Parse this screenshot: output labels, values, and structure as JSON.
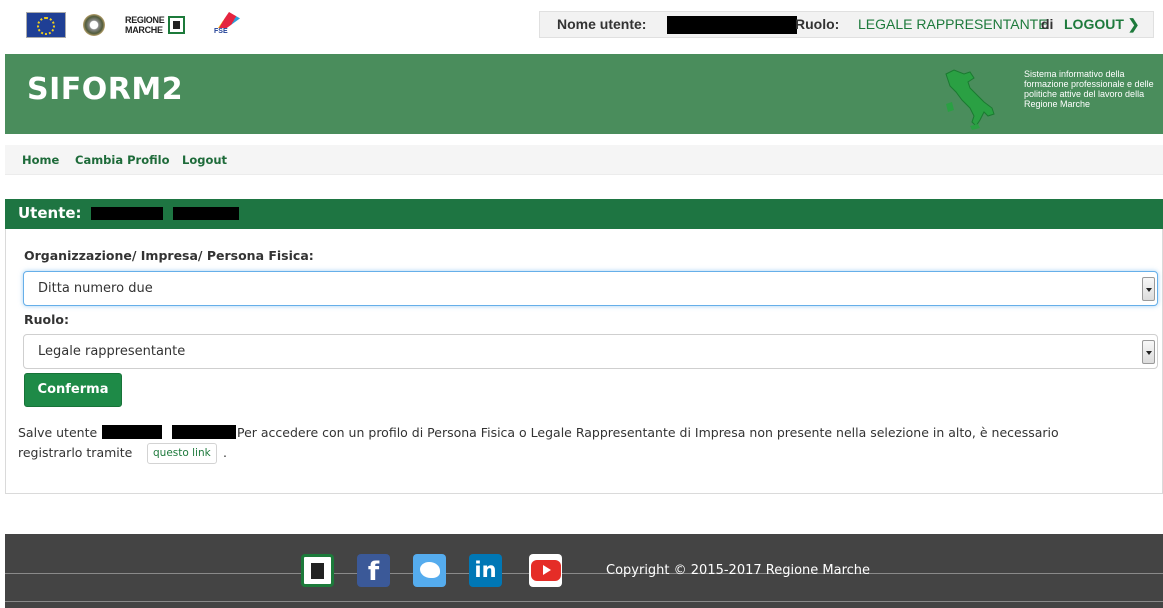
{
  "topbar": {
    "logos": {
      "eu": "eu-flag-logo",
      "italy": "italian-republic-emblem",
      "region": "REGIONE MARCHE",
      "fse": "FSE"
    },
    "user": {
      "username_label": "Nome utente:",
      "role_label": "Ruolo:",
      "role_value": "LEGALE RAPPRESENTANTE",
      "di": "di",
      "logout": "LOGOUT ❯"
    }
  },
  "header": {
    "brand": "SIFORM2",
    "description": "Sistema informativo della formazione professionale e delle politiche attive del lavoro della Regione Marche"
  },
  "nav": {
    "items": [
      "Home",
      "Cambia Profilo",
      "Logout"
    ]
  },
  "panel": {
    "title": "Utente:",
    "org_label": "Organizzazione/ Impresa/ Persona Fisica:",
    "org_value": "Ditta numero due",
    "role_label": "Ruolo:",
    "role_value": "Legale rappresentante",
    "confirm": "Conferma",
    "note_prefix": "Salve utente",
    "note_line1": "Per accedere con un profilo di Persona Fisica o Legale Rappresentante di Impresa non presente nella selezione in alto, è necessario",
    "note_line2": "registrarlo tramite",
    "note_link": "questo link",
    "note_end": "."
  },
  "footer": {
    "icons": [
      "regione-marche-icon",
      "facebook-icon",
      "twitter-icon",
      "linkedin-icon",
      "youtube-icon"
    ],
    "copyright": "Copyright © 2015-2017 Regione Marche"
  },
  "colors": {
    "header_green": "#4a8d5c",
    "panel_green": "#1e7542",
    "link_green": "#1e7a3c",
    "footer_gray": "#444444"
  }
}
